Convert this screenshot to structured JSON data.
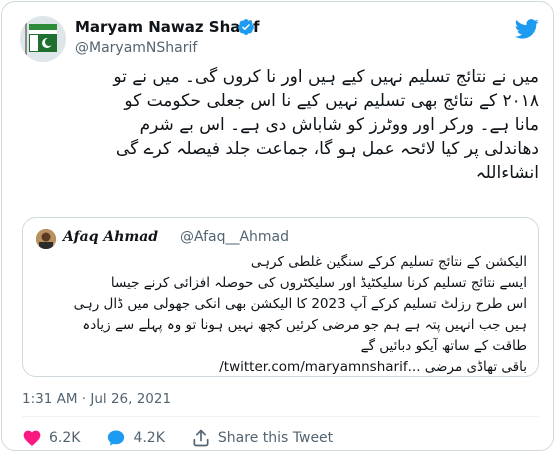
{
  "author": {
    "name": "Maryam Nawaz Sharif",
    "handle": "@MaryamNSharif"
  },
  "tweet": {
    "lines": [
      "میں نے نتائج تسلیم نہیں کیے ہیں اور نا کروں گی۔ میں نے تو",
      "۲۰۱۸ کے نتائج بھی تسلیم نہیں کیے نا اس جعلی حکومت کو",
      "مانا ہے۔ ورکر اور ووٹرز کو شاباش دی ہے۔ اس بے شرم",
      "دھاندلی پر کیا لائحہ عمل ہو گا، جماعت جلد فیصلہ کرے گی",
      "انشاءاللہ"
    ]
  },
  "quote": {
    "name": "Afaq Ahmad",
    "handle": "@Afaq__Ahmad",
    "lines": [
      "الیکشن کے نتائج تسلیم کرکے سنگین غلطی کرہی",
      "ایسے نتائج تسلیم کرنا سلیکٹیڈ اور سلیکٹروں کی حوصلہ افزائی کرنے جیسا",
      "اس طرح رزلٹ تسلیم کرکے آپ 2023 کا الیکشن بھی انکی جھولی میں ڈال رہی",
      "ہیں جب انہیں پتہ ہے ہم جو مرضی کرئیں کچھ نہیں ہونا تو وہ پہلے سے زیادہ",
      "طاقت کے ساتھ آیکو دبائیں گے"
    ],
    "link_text": "باقی تھاڈی مرضی ...twitter.com/maryamnsharif/"
  },
  "timestamp": "1:31 AM · Jul 26, 2021",
  "actions": {
    "likes": "6.2K",
    "replies": "4.2K",
    "share_label": "Share this Tweet"
  },
  "colors": {
    "accent": "#1d9bf0",
    "like": "#f91880",
    "secondary_text": "#536471",
    "border": "#cfd9de"
  }
}
